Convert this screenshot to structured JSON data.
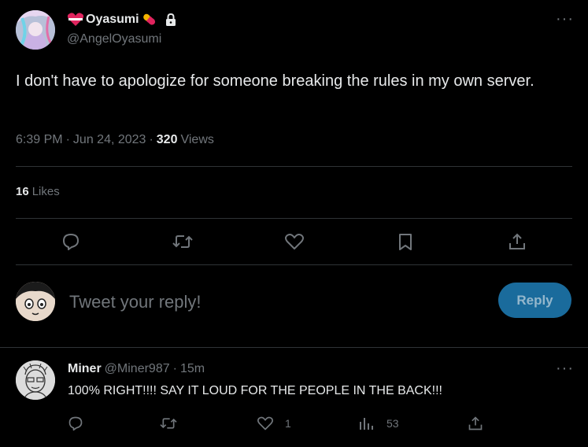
{
  "tweet": {
    "author": {
      "display_name": "Oyasumi",
      "emoji_left": "heart-with-ribbon",
      "emoji_right": "pill",
      "handle": "@AngelOyasumi",
      "locked": true
    },
    "text": "I don't have to apologize for someone breaking the rules in my own server.",
    "time": "6:39 PM",
    "dot": "·",
    "date": "Jun 24, 2023",
    "views_count": "320",
    "views_label": "Views",
    "likes_count": "16",
    "likes_label": "Likes",
    "more": "···"
  },
  "actions": [
    "reply-icon",
    "retweet-icon",
    "like-icon",
    "bookmark-icon",
    "share-icon"
  ],
  "composer": {
    "placeholder": "Tweet your reply!",
    "button": "Reply"
  },
  "reply": {
    "name": "Miner",
    "handle": "@Miner987",
    "dot": "·",
    "time": "15m",
    "text": "100% RIGHT!!!! SAY IT LOUD FOR THE PEOPLE IN THE BACK!!!",
    "more": "···",
    "like_count": "1",
    "views_count": "53"
  },
  "colors": {
    "background": "#000000",
    "text": "#e7e9ea",
    "muted": "#71767b",
    "divider": "#2f3336",
    "reply_button": "#1a6b9c"
  }
}
